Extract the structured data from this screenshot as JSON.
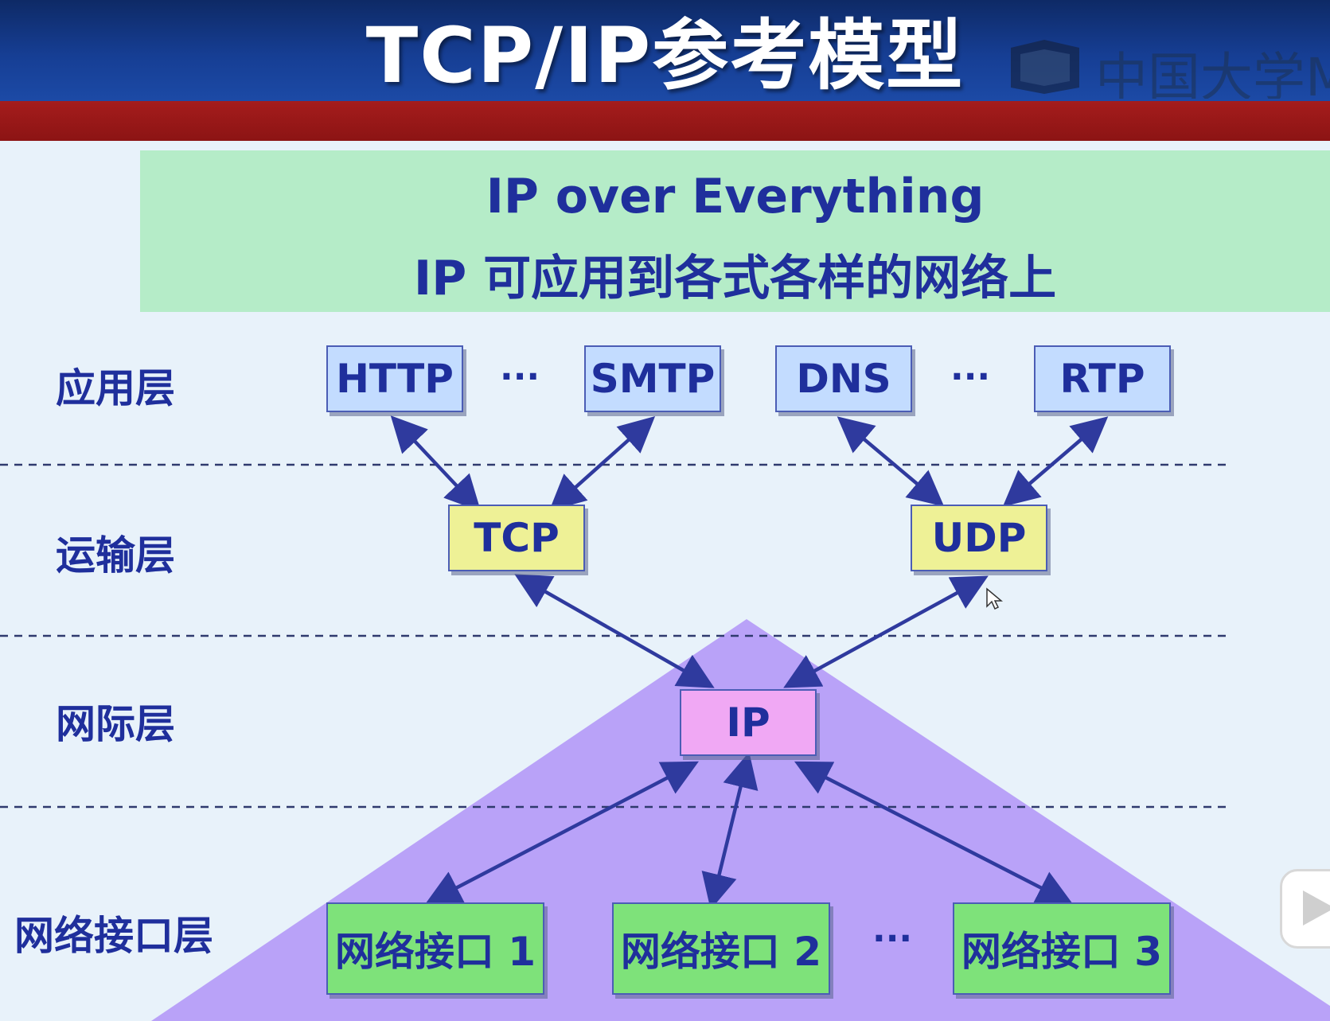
{
  "header": {
    "title": "TCP/IP参考模型",
    "watermark_text": "中国大学M"
  },
  "banner": {
    "line1": "IP over Everything",
    "line2": "IP 可应用到各式各样的网络上"
  },
  "layers": {
    "application": "应用层",
    "transport": "运输层",
    "internet": "网际层",
    "network_interface": "网络接口层"
  },
  "application_protocols": [
    "HTTP",
    "SMTP",
    "DNS",
    "RTP"
  ],
  "transport_protocols": [
    "TCP",
    "UDP"
  ],
  "internet_protocol": "IP",
  "network_interfaces": [
    "网络接口 1",
    "网络接口 2",
    "网络接口 3"
  ],
  "ellipsis": "···",
  "colors": {
    "header_blue": "#163e94",
    "red_band": "#9a1818",
    "banner_green": "#b5ecc8",
    "text_navy": "#1f2f9c",
    "app_box": "#c3dcff",
    "transport_box": "#eef196",
    "ip_box": "#f0a8f4",
    "net_box": "#7ee27a",
    "triangle_purple": "#b9a2f8"
  }
}
